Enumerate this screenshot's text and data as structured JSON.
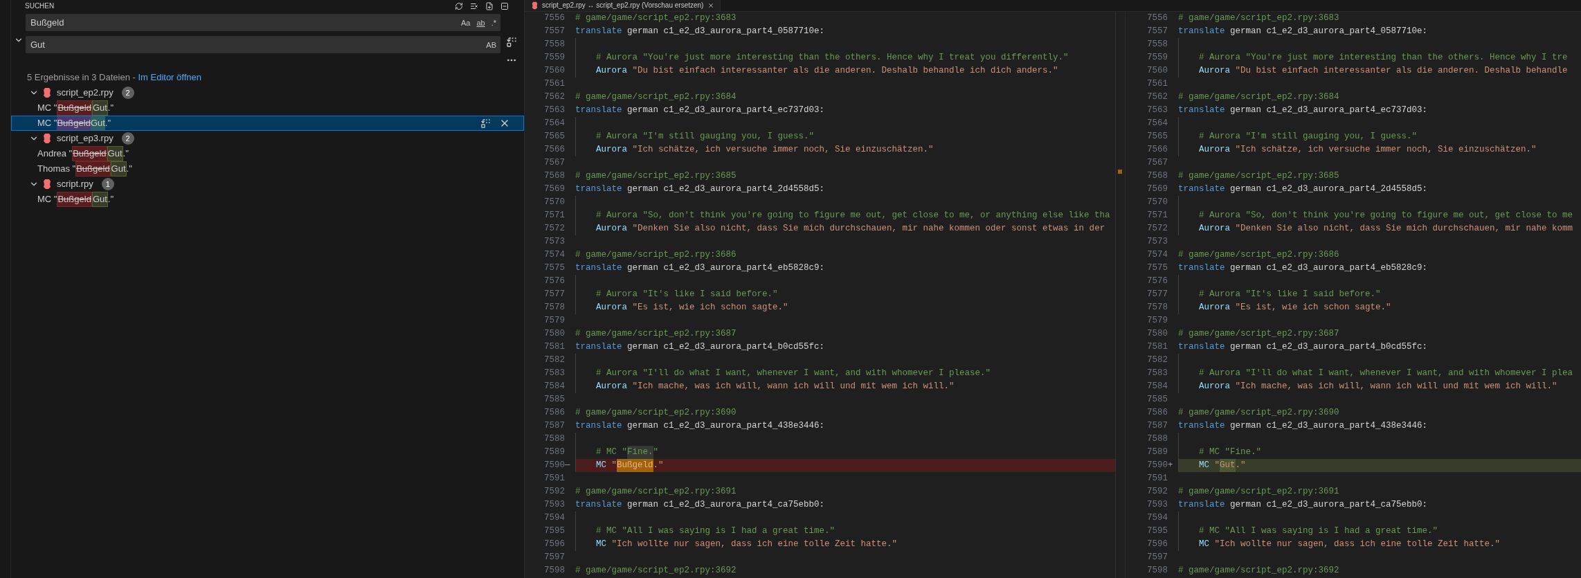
{
  "sidebar": {
    "title": "SUCHEN",
    "expanded": true,
    "search": {
      "value": "Bußgeld",
      "options": [
        {
          "label": "Aa",
          "on": false
        },
        {
          "label": "ab",
          "on": false
        },
        {
          "label": ".*",
          "on": false
        }
      ]
    },
    "replace": {
      "value": "Gut",
      "options": [
        {
          "label": "AB",
          "on": false
        }
      ]
    },
    "summary": "5 Ergebnisse in 3 Dateien - ",
    "summary_link": "Im Editor öffnen",
    "files": [
      {
        "name": "script_ep2.rpy",
        "count": "2",
        "expanded": true,
        "matches": [
          {
            "prefix": "MC \"",
            "removed": "Bußgeld",
            "added": "Gut",
            "suffix": ".\"",
            "selected": false
          },
          {
            "prefix": "MC \"",
            "removed": "Bußgeld",
            "added": "Gut",
            "suffix": ".\"",
            "selected": true
          }
        ]
      },
      {
        "name": "script_ep3.rpy",
        "count": "2",
        "expanded": true,
        "matches": [
          {
            "prefix": "Andrea \"",
            "removed": "Bußgeld",
            "added": "Gut",
            "suffix": ".\"",
            "selected": false
          },
          {
            "prefix": "Thomas \"",
            "removed": "Bußgeld",
            "added": "Gut",
            "suffix": ".\"",
            "selected": false
          }
        ]
      },
      {
        "name": "script.rpy",
        "count": "1",
        "expanded": true,
        "matches": [
          {
            "prefix": "MC \"",
            "removed": "Bußgeld",
            "added": "Gut",
            "suffix": ".\"",
            "selected": false
          }
        ]
      }
    ]
  },
  "editor": {
    "tab": {
      "label": "script_ep2.rpy ↔ script_ep2.rpy (Vorschau ersetzen)"
    },
    "original": {
      "lines": [
        {
          "number": "7556",
          "indented": false,
          "kind": "context",
          "tokens": [
            {
              "kind": "comment",
              "text": "# game/game/script_ep2.rpy:3683"
            }
          ]
        },
        {
          "number": "7557",
          "indented": false,
          "kind": "context",
          "tokens": [
            {
              "kind": "keyword",
              "text": "translate"
            },
            {
              "kind": "plain",
              "text": " german c1_e2_d3_aurora_part4_0587710e:"
            }
          ]
        },
        {
          "number": "7558",
          "indented": true,
          "kind": "context"
        },
        {
          "number": "7559",
          "indented": true,
          "kind": "context",
          "tokens": [
            {
              "kind": "comment",
              "text": "# Aurora \"You're just more interesting than the others. Hence why I treat you differently.\""
            }
          ]
        },
        {
          "number": "7560",
          "indented": true,
          "kind": "context",
          "tokens": [
            {
              "kind": "speaker",
              "text": "Aurora"
            },
            {
              "kind": "string",
              "text": " \"Du bist einfach interessanter als die anderen. Deshalb behandle ich dich anders.\""
            }
          ]
        },
        {
          "number": "7561",
          "indented": false,
          "kind": "context"
        },
        {
          "number": "7562",
          "indented": false,
          "kind": "context",
          "tokens": [
            {
              "kind": "comment",
              "text": "# game/game/script_ep2.rpy:3684"
            }
          ]
        },
        {
          "number": "7563",
          "indented": false,
          "kind": "context",
          "tokens": [
            {
              "kind": "keyword",
              "text": "translate"
            },
            {
              "kind": "plain",
              "text": " german c1_e2_d3_aurora_part4_ec737d03:"
            }
          ]
        },
        {
          "number": "7564",
          "indented": true,
          "kind": "context"
        },
        {
          "number": "7565",
          "indented": true,
          "kind": "context",
          "tokens": [
            {
              "kind": "comment",
              "text": "# Aurora \"I'm still gauging you, I guess.\""
            }
          ]
        },
        {
          "number": "7566",
          "indented": true,
          "kind": "context",
          "tokens": [
            {
              "kind": "speaker",
              "text": "Aurora"
            },
            {
              "kind": "string",
              "text": " \"Ich schätze, ich versuche immer noch, Sie einzuschätzen.\""
            }
          ]
        },
        {
          "number": "7567",
          "indented": false,
          "kind": "context"
        },
        {
          "number": "7568",
          "indented": false,
          "kind": "context",
          "tokens": [
            {
              "kind": "comment",
              "text": "# game/game/script_ep2.rpy:3685"
            }
          ]
        },
        {
          "number": "7569",
          "indented": false,
          "kind": "context",
          "tokens": [
            {
              "kind": "keyword",
              "text": "translate"
            },
            {
              "kind": "plain",
              "text": " german c1_e2_d3_aurora_part4_2d4558d5:"
            }
          ]
        },
        {
          "number": "7570",
          "indented": true,
          "kind": "context"
        },
        {
          "number": "7571",
          "indented": true,
          "kind": "context",
          "tokens": [
            {
              "kind": "comment",
              "text": "# Aurora \"So, don't think you're going to figure me out, get close to me, or anything else like tha"
            }
          ]
        },
        {
          "number": "7572",
          "indented": true,
          "kind": "context",
          "tokens": [
            {
              "kind": "speaker",
              "text": "Aurora"
            },
            {
              "kind": "string",
              "text": " \"Denken Sie also nicht, dass Sie mich durchschauen, mir nahe kommen oder sonst etwas in der"
            }
          ]
        },
        {
          "number": "7573",
          "indented": false,
          "kind": "context"
        },
        {
          "number": "7574",
          "indented": false,
          "kind": "context",
          "tokens": [
            {
              "kind": "comment",
              "text": "# game/game/script_ep2.rpy:3686"
            }
          ]
        },
        {
          "number": "7575",
          "indented": false,
          "kind": "context",
          "tokens": [
            {
              "kind": "keyword",
              "text": "translate"
            },
            {
              "kind": "plain",
              "text": " german c1_e2_d3_aurora_part4_eb5828c9:"
            }
          ]
        },
        {
          "number": "7576",
          "indented": true,
          "kind": "context"
        },
        {
          "number": "7577",
          "indented": true,
          "kind": "context",
          "tokens": [
            {
              "kind": "comment",
              "text": "# Aurora \"It's like I said before.\""
            }
          ]
        },
        {
          "number": "7578",
          "indented": true,
          "kind": "context",
          "tokens": [
            {
              "kind": "speaker",
              "text": "Aurora"
            },
            {
              "kind": "string",
              "text": " \"Es ist, wie ich schon sagte.\""
            }
          ]
        },
        {
          "number": "7579",
          "indented": false,
          "kind": "context"
        },
        {
          "number": "7580",
          "indented": false,
          "kind": "context",
          "tokens": [
            {
              "kind": "comment",
              "text": "# game/game/script_ep2.rpy:3687"
            }
          ]
        },
        {
          "number": "7581",
          "indented": false,
          "kind": "context",
          "tokens": [
            {
              "kind": "keyword",
              "text": "translate"
            },
            {
              "kind": "plain",
              "text": " german c1_e2_d3_aurora_part4_b0cd55fc:"
            }
          ]
        },
        {
          "number": "7582",
          "indented": true,
          "kind": "context"
        },
        {
          "number": "7583",
          "indented": true,
          "kind": "context",
          "tokens": [
            {
              "kind": "comment",
              "text": "# Aurora \"I'll do what I want, whenever I want, and with whomever I please.\""
            }
          ]
        },
        {
          "number": "7584",
          "indented": true,
          "kind": "context",
          "tokens": [
            {
              "kind": "speaker",
              "text": "Aurora"
            },
            {
              "kind": "string",
              "text": " \"Ich mache, was ich will, wann ich will und mit wem ich will.\""
            }
          ]
        },
        {
          "number": "7585",
          "indented": false,
          "kind": "context"
        },
        {
          "number": "7586",
          "indented": false,
          "kind": "context",
          "tokens": [
            {
              "kind": "comment",
              "text": "# game/game/script_ep2.rpy:3690"
            }
          ]
        },
        {
          "number": "7587",
          "indented": false,
          "kind": "context",
          "tokens": [
            {
              "kind": "keyword",
              "text": "translate"
            },
            {
              "kind": "plain",
              "text": " german c1_e2_d3_aurora_part4_438e3446:"
            }
          ]
        },
        {
          "number": "7588",
          "indented": true,
          "kind": "context"
        },
        {
          "number": "7589",
          "indented": true,
          "kind": "context",
          "tokens": [
            {
              "kind": "comment",
              "text": "# MC \""
            },
            {
              "kind": "comment_occurrence",
              "text": "Fine."
            },
            {
              "kind": "comment",
              "text": "\""
            }
          ]
        },
        {
          "number": "7590",
          "indented": true,
          "kind": "removed",
          "gutter_mark": "—",
          "tokens": [
            {
              "kind": "speaker",
              "text": "MC"
            },
            {
              "kind": "string",
              "text": " \""
            },
            {
              "kind": "string_removed",
              "text": "Bußgeld"
            },
            {
              "kind": "string",
              "text": ".\""
            }
          ]
        },
        {
          "number": "7591",
          "indented": false,
          "kind": "context"
        },
        {
          "number": "7592",
          "indented": false,
          "kind": "context",
          "tokens": [
            {
              "kind": "comment",
              "text": "# game/game/script_ep2.rpy:3691"
            }
          ]
        },
        {
          "number": "7593",
          "indented": false,
          "kind": "context",
          "tokens": [
            {
              "kind": "keyword",
              "text": "translate"
            },
            {
              "kind": "plain",
              "text": " german c1_e2_d3_aurora_part4_ca75ebb0:"
            }
          ]
        },
        {
          "number": "7594",
          "indented": true,
          "kind": "context"
        },
        {
          "number": "7595",
          "indented": true,
          "kind": "context",
          "tokens": [
            {
              "kind": "comment",
              "text": "# MC \"All I was saying is I had a great time.\""
            }
          ]
        },
        {
          "number": "7596",
          "indented": true,
          "kind": "context",
          "tokens": [
            {
              "kind": "speaker",
              "text": "MC"
            },
            {
              "kind": "string",
              "text": " \"Ich wollte nur sagen, dass ich eine tolle Zeit hatte.\""
            }
          ]
        },
        {
          "number": "7597",
          "indented": false,
          "kind": "context"
        },
        {
          "number": "7598",
          "indented": false,
          "kind": "context",
          "tokens": [
            {
              "kind": "comment",
              "text": "# game/game/script_ep2.rpy:3692"
            }
          ]
        }
      ]
    },
    "modified": {
      "lines": [
        {
          "number": "7556",
          "indented": false,
          "kind": "context",
          "tokens": [
            {
              "kind": "comment",
              "text": "# game/game/script_ep2.rpy:3683"
            }
          ]
        },
        {
          "number": "7557",
          "indented": false,
          "kind": "context",
          "tokens": [
            {
              "kind": "keyword",
              "text": "translate"
            },
            {
              "kind": "plain",
              "text": " german c1_e2_d3_aurora_part4_0587710e:"
            }
          ]
        },
        {
          "number": "7558",
          "indented": true,
          "kind": "context"
        },
        {
          "number": "7559",
          "indented": true,
          "kind": "context",
          "tokens": [
            {
              "kind": "comment",
              "text": "# Aurora \"You're just more interesting than the others. Hence why I tre"
            }
          ]
        },
        {
          "number": "7560",
          "indented": true,
          "kind": "context",
          "tokens": [
            {
              "kind": "speaker",
              "text": "Aurora"
            },
            {
              "kind": "string",
              "text": " \"Du bist einfach interessanter als die anderen. Deshalb behandle"
            }
          ]
        },
        {
          "number": "7561",
          "indented": false,
          "kind": "context"
        },
        {
          "number": "7562",
          "indented": false,
          "kind": "context",
          "tokens": [
            {
              "kind": "comment",
              "text": "# game/game/script_ep2.rpy:3684"
            }
          ]
        },
        {
          "number": "7563",
          "indented": false,
          "kind": "context",
          "tokens": [
            {
              "kind": "keyword",
              "text": "translate"
            },
            {
              "kind": "plain",
              "text": " german c1_e2_d3_aurora_part4_ec737d03:"
            }
          ]
        },
        {
          "number": "7564",
          "indented": true,
          "kind": "context"
        },
        {
          "number": "7565",
          "indented": true,
          "kind": "context",
          "tokens": [
            {
              "kind": "comment",
              "text": "# Aurora \"I'm still gauging you, I guess.\""
            }
          ]
        },
        {
          "number": "7566",
          "indented": true,
          "kind": "context",
          "tokens": [
            {
              "kind": "speaker",
              "text": "Aurora"
            },
            {
              "kind": "string",
              "text": " \"Ich schätze, ich versuche immer noch, Sie einzuschätzen.\""
            }
          ]
        },
        {
          "number": "7567",
          "indented": false,
          "kind": "context"
        },
        {
          "number": "7568",
          "indented": false,
          "kind": "context",
          "tokens": [
            {
              "kind": "comment",
              "text": "# game/game/script_ep2.rpy:3685"
            }
          ]
        },
        {
          "number": "7569",
          "indented": false,
          "kind": "context",
          "tokens": [
            {
              "kind": "keyword",
              "text": "translate"
            },
            {
              "kind": "plain",
              "text": " german c1_e2_d3_aurora_part4_2d4558d5:"
            }
          ]
        },
        {
          "number": "7570",
          "indented": true,
          "kind": "context"
        },
        {
          "number": "7571",
          "indented": true,
          "kind": "context",
          "tokens": [
            {
              "kind": "comment",
              "text": "# Aurora \"So, don't think you're going to figure me out, get close to me"
            }
          ]
        },
        {
          "number": "7572",
          "indented": true,
          "kind": "context",
          "tokens": [
            {
              "kind": "speaker",
              "text": "Aurora"
            },
            {
              "kind": "string",
              "text": " \"Denken Sie also nicht, dass Sie mich durchschauen, mir nahe komm"
            }
          ]
        },
        {
          "number": "7573",
          "indented": false,
          "kind": "context"
        },
        {
          "number": "7574",
          "indented": false,
          "kind": "context",
          "tokens": [
            {
              "kind": "comment",
              "text": "# game/game/script_ep2.rpy:3686"
            }
          ]
        },
        {
          "number": "7575",
          "indented": false,
          "kind": "context",
          "tokens": [
            {
              "kind": "keyword",
              "text": "translate"
            },
            {
              "kind": "plain",
              "text": " german c1_e2_d3_aurora_part4_eb5828c9:"
            }
          ]
        },
        {
          "number": "7576",
          "indented": true,
          "kind": "context"
        },
        {
          "number": "7577",
          "indented": true,
          "kind": "context",
          "tokens": [
            {
              "kind": "comment",
              "text": "# Aurora \"It's like I said before.\""
            }
          ]
        },
        {
          "number": "7578",
          "indented": true,
          "kind": "context",
          "tokens": [
            {
              "kind": "speaker",
              "text": "Aurora"
            },
            {
              "kind": "string",
              "text": " \"Es ist, wie ich schon sagte.\""
            }
          ]
        },
        {
          "number": "7579",
          "indented": false,
          "kind": "context"
        },
        {
          "number": "7580",
          "indented": false,
          "kind": "context",
          "tokens": [
            {
              "kind": "comment",
              "text": "# game/game/script_ep2.rpy:3687"
            }
          ]
        },
        {
          "number": "7581",
          "indented": false,
          "kind": "context",
          "tokens": [
            {
              "kind": "keyword",
              "text": "translate"
            },
            {
              "kind": "plain",
              "text": " german c1_e2_d3_aurora_part4_b0cd55fc:"
            }
          ]
        },
        {
          "number": "7582",
          "indented": true,
          "kind": "context"
        },
        {
          "number": "7583",
          "indented": true,
          "kind": "context",
          "tokens": [
            {
              "kind": "comment",
              "text": "# Aurora \"I'll do what I want, whenever I want, and with whomever I plea"
            }
          ]
        },
        {
          "number": "7584",
          "indented": true,
          "kind": "context",
          "tokens": [
            {
              "kind": "speaker",
              "text": "Aurora"
            },
            {
              "kind": "string",
              "text": " \"Ich mache, was ich will, wann ich will und mit wem ich will.\""
            }
          ]
        },
        {
          "number": "7585",
          "indented": false,
          "kind": "context"
        },
        {
          "number": "7586",
          "indented": false,
          "kind": "context",
          "tokens": [
            {
              "kind": "comment",
              "text": "# game/game/script_ep2.rpy:3690"
            }
          ]
        },
        {
          "number": "7587",
          "indented": false,
          "kind": "context",
          "tokens": [
            {
              "kind": "keyword",
              "text": "translate"
            },
            {
              "kind": "plain",
              "text": " german c1_e2_d3_aurora_part4_438e3446:"
            }
          ]
        },
        {
          "number": "7588",
          "indented": true,
          "kind": "context"
        },
        {
          "number": "7589",
          "indented": true,
          "kind": "context",
          "tokens": [
            {
              "kind": "comment",
              "text": "# MC \"Fine.\""
            }
          ]
        },
        {
          "number": "7590",
          "indented": true,
          "kind": "added",
          "gutter_mark": "+",
          "tokens": [
            {
              "kind": "speaker",
              "text": "MC"
            },
            {
              "kind": "string",
              "text": " \""
            },
            {
              "kind": "string_added",
              "text": "Gut"
            },
            {
              "kind": "string",
              "text": ".\""
            }
          ]
        },
        {
          "number": "7591",
          "indented": false,
          "kind": "context"
        },
        {
          "number": "7592",
          "indented": false,
          "kind": "context",
          "tokens": [
            {
              "kind": "comment",
              "text": "# game/game/script_ep2.rpy:3691"
            }
          ]
        },
        {
          "number": "7593",
          "indented": false,
          "kind": "context",
          "tokens": [
            {
              "kind": "keyword",
              "text": "translate"
            },
            {
              "kind": "plain",
              "text": " german c1_e2_d3_aurora_part4_ca75ebb0:"
            }
          ]
        },
        {
          "number": "7594",
          "indented": true,
          "kind": "context"
        },
        {
          "number": "7595",
          "indented": true,
          "kind": "context",
          "tokens": [
            {
              "kind": "comment",
              "text": "# MC \"All I was saying is I had a great time.\""
            }
          ]
        },
        {
          "number": "7596",
          "indented": true,
          "kind": "context",
          "tokens": [
            {
              "kind": "speaker",
              "text": "MC"
            },
            {
              "kind": "string",
              "text": " \"Ich wollte nur sagen, dass ich eine tolle Zeit hatte.\""
            }
          ]
        },
        {
          "number": "7597",
          "indented": false,
          "kind": "context"
        },
        {
          "number": "7598",
          "indented": false,
          "kind": "context",
          "tokens": [
            {
              "kind": "comment",
              "text": "# game/game/script_ep2.rpy:3692"
            }
          ]
        }
      ]
    }
  }
}
